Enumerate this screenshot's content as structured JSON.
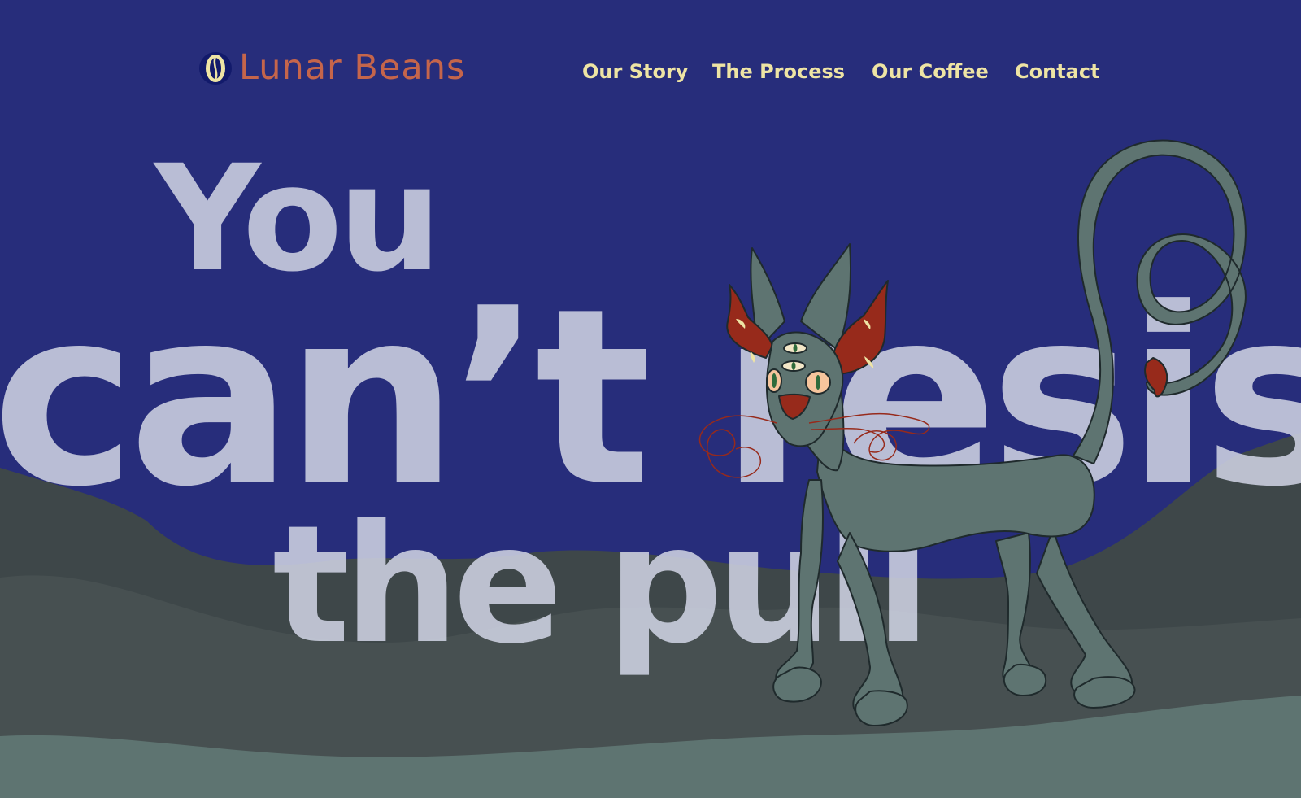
{
  "brand": {
    "name": "Lunar Beans",
    "logo_icon": "coffee-bean-moon-icon"
  },
  "nav": {
    "items": [
      {
        "label": "Our Story"
      },
      {
        "label": "The Process"
      },
      {
        "label": "Our Coffee"
      },
      {
        "label": "Contact"
      }
    ]
  },
  "hero": {
    "line1": "You",
    "line2": "can’t resist",
    "line3": "the pull"
  },
  "colors": {
    "background": "#272d7b",
    "logo": "#c5654b",
    "nav": "#eee4a4",
    "headline": "#ced2e1",
    "hill_far": "#3e4749",
    "hill_mid": "#475051",
    "ground": "#5e7471",
    "cat_body": "#5e7471",
    "horns": "#972a1b"
  }
}
